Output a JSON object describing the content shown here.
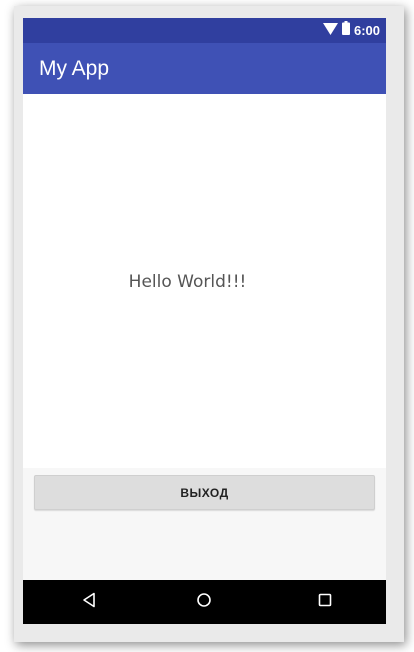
{
  "status_bar": {
    "time": "6:00",
    "icons": [
      "wifi-icon",
      "battery-icon"
    ],
    "background_color": "#303f9f"
  },
  "app_bar": {
    "title": "My App",
    "background_color": "#3f51b5"
  },
  "content": {
    "message": "Hello World!!!"
  },
  "actions": {
    "exit_label": "ВЫХОД"
  },
  "navigation_bar": {
    "buttons": [
      "back-icon",
      "home-icon",
      "recents-icon"
    ]
  }
}
